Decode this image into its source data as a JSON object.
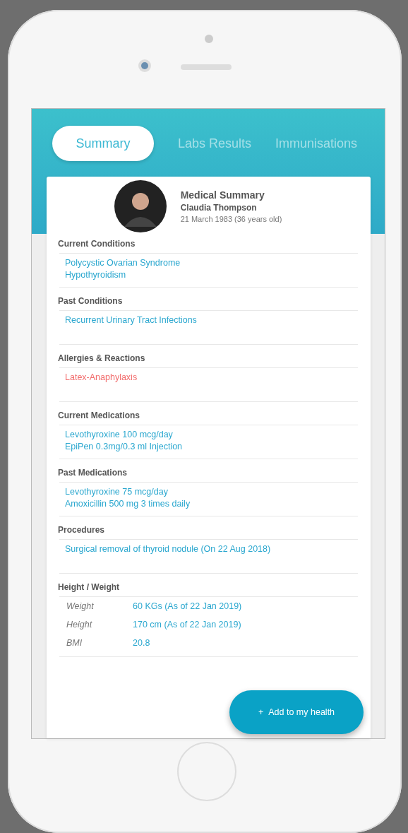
{
  "tabs": [
    {
      "label": "Summary",
      "selected": true
    },
    {
      "label": "Labs Results",
      "selected": false
    },
    {
      "label": "Immunisations",
      "selected": false
    }
  ],
  "profile": {
    "title": "Medical Summary",
    "name": "Claudia Thompson",
    "birth": "21 March 1983 (36 years old)"
  },
  "sections": [
    {
      "title": "Current Conditions",
      "kind": "list",
      "items": [
        {
          "text": "Polycystic Ovarian Syndrome",
          "kind": "normal"
        },
        {
          "text": "Hypothyroidism",
          "kind": "normal"
        }
      ]
    },
    {
      "title": "Past Conditions",
      "kind": "list",
      "items": [
        {
          "text": "Recurrent Urinary Tract Infections",
          "kind": "normal"
        }
      ]
    },
    {
      "title": "Allergies & Reactions",
      "kind": "list",
      "items": [
        {
          "text": "Latex-Anaphylaxis",
          "kind": "alert"
        }
      ]
    },
    {
      "title": "Current Medications",
      "kind": "list",
      "items": [
        {
          "text": "Levothyroxine 100 mcg/day",
          "kind": "normal"
        },
        {
          "text": "EpiPen 0.3mg/0.3 ml Injection",
          "kind": "normal"
        }
      ]
    },
    {
      "title": "Past Medications",
      "kind": "list",
      "items": [
        {
          "text": "Levothyroxine 75 mcg/day",
          "kind": "normal"
        },
        {
          "text": "Amoxicillin  500 mg 3 times daily",
          "kind": "normal"
        }
      ]
    },
    {
      "title": "Procedures",
      "kind": "list",
      "items": [
        {
          "text": "Surgical removal of thyroid nodule (On 22 Aug 2018)",
          "kind": "normal"
        }
      ]
    },
    {
      "title": "Height / Weight",
      "kind": "table",
      "rows": [
        {
          "label": "Weight",
          "value": "60 KGs (As of 22 Jan 2019)"
        },
        {
          "label": "Height",
          "value": "170 cm (As of 22 Jan 2019)"
        },
        {
          "label": "BMI",
          "value": "20.8"
        }
      ]
    }
  ],
  "action": {
    "icon": "+",
    "label": "Add to my health"
  }
}
